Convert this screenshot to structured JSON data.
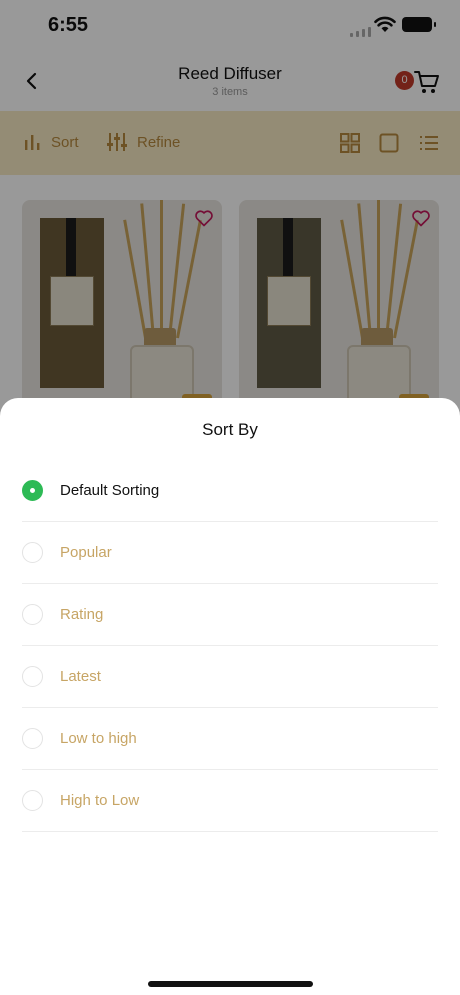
{
  "status": {
    "time": "6:55"
  },
  "header": {
    "title": "Reed Diffuser",
    "subtitle": "3 items",
    "cart_count": "0"
  },
  "toolbar": {
    "sort": "Sort",
    "refine": "Refine"
  },
  "sheet": {
    "title": "Sort By",
    "options": [
      {
        "label": "Default Sorting",
        "selected": true
      },
      {
        "label": "Popular",
        "selected": false
      },
      {
        "label": "Rating",
        "selected": false
      },
      {
        "label": "Latest",
        "selected": false
      },
      {
        "label": "Low to high",
        "selected": false
      },
      {
        "label": "High to Low",
        "selected": false
      }
    ]
  },
  "colors": {
    "accent": "#c7a565",
    "selected": "#2dba55",
    "toolbar_bg": "#f7e9c4",
    "badge": "#c0392b",
    "heart": "#c2185b"
  },
  "icons": [
    "back-arrow-icon",
    "cart-icon",
    "sort-icon",
    "refine-icon",
    "grid-view-icon",
    "single-view-icon",
    "list-view-icon",
    "heart-icon"
  ]
}
